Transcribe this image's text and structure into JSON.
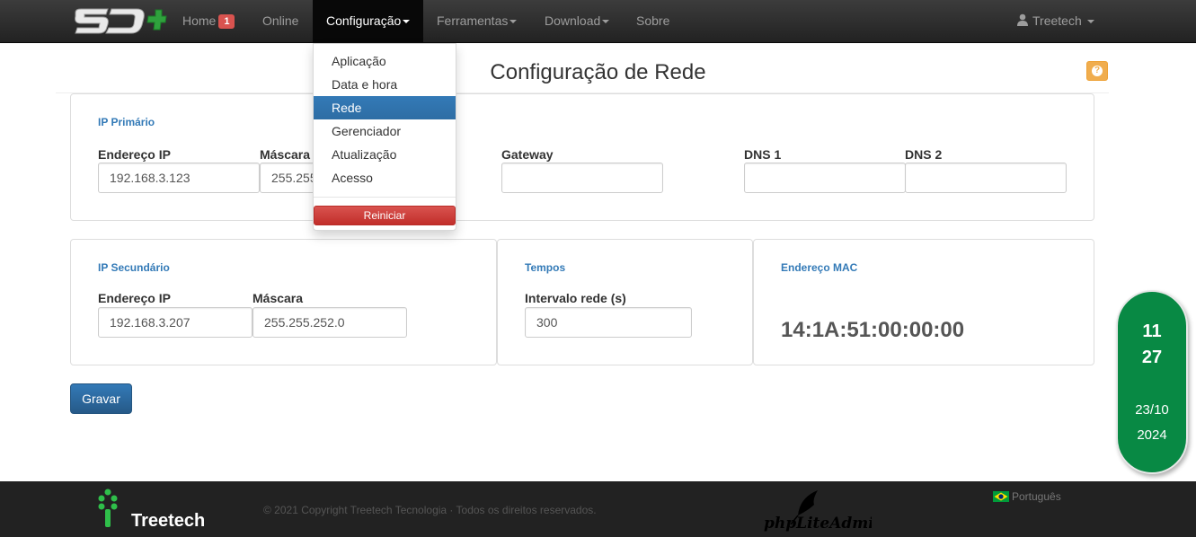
{
  "navbar": {
    "brand_text": "SD+",
    "home_label": "Home",
    "home_badge": "1",
    "online_label": "Online",
    "config_label": "Configuração",
    "tools_label": "Ferramentas",
    "download_label": "Download",
    "about_label": "Sobre",
    "user_label": "Treetech"
  },
  "config_menu": {
    "items": [
      "Aplicação",
      "Data e hora",
      "Rede",
      "Gerenciador",
      "Atualização",
      "Acesso"
    ],
    "active": "Rede",
    "restart_label": "Reiniciar"
  },
  "page": {
    "title": "Configuração de Rede"
  },
  "primary_ip": {
    "legend": "IP Primário",
    "ip_label": "Endereço IP",
    "ip_value": "192.168.3.123",
    "mask_label": "Máscara",
    "mask_value": "255.255.252.0",
    "gateway_label": "Gateway",
    "gateway_value": "",
    "dns1_label": "DNS 1",
    "dns1_value": "",
    "dns2_label": "DNS 2",
    "dns2_value": ""
  },
  "secondary_ip": {
    "legend": "IP Secundário",
    "ip_label": "Endereço IP",
    "ip_value": "192.168.3.207",
    "mask_label": "Máscara",
    "mask_value": "255.255.252.0"
  },
  "times": {
    "legend": "Tempos",
    "interval_label": "Intervalo rede (s)",
    "interval_value": "300"
  },
  "mac": {
    "legend": "Endereço MAC",
    "value": "14:1A:51:00:00:00"
  },
  "save_label": "Gravar",
  "clock": {
    "hour": "11",
    "minute": "27",
    "date": "23/10",
    "year": "2024"
  },
  "footer": {
    "company_logo_text": "Treetech",
    "copyright": "© 2021 Copyright Treetech Tecnologia · Todos os direitos reservados.",
    "php_logo_text": "phpLiteAdmin",
    "language": "Português"
  },
  "colors": {
    "primary": "#337ab7",
    "danger": "#d9534f",
    "warning": "#f0ad4e",
    "clock_green": "#088944",
    "navbar": "#222222"
  }
}
